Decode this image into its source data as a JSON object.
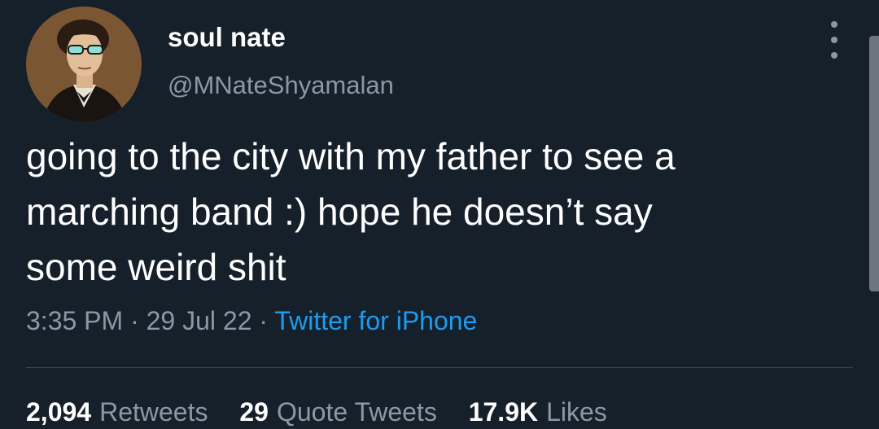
{
  "colors": {
    "background": "#15202b",
    "primary_text": "#ffffff",
    "secondary_text": "#8b98a5",
    "link": "#1d9bf0",
    "divider": "#38444d"
  },
  "author": {
    "display_name": "soul nate",
    "handle": "@MNateShyamalan",
    "avatar_icon": "profile-avatar"
  },
  "menu": {
    "icon": "more-vertical-icon"
  },
  "tweet": {
    "text_lines": [
      "going to the city with my father to see a",
      "marching band :) hope he doesn’t say",
      "some weird shit"
    ],
    "time": "3:35 PM",
    "separator": " · ",
    "date": "29 Jul 22",
    "source": "Twitter for iPhone"
  },
  "stats": {
    "retweets": {
      "count": "2,094",
      "label": "Retweets"
    },
    "quote_tweets": {
      "count": "29",
      "label": "Quote Tweets"
    },
    "likes": {
      "count": "17.9K",
      "label": "Likes"
    }
  }
}
